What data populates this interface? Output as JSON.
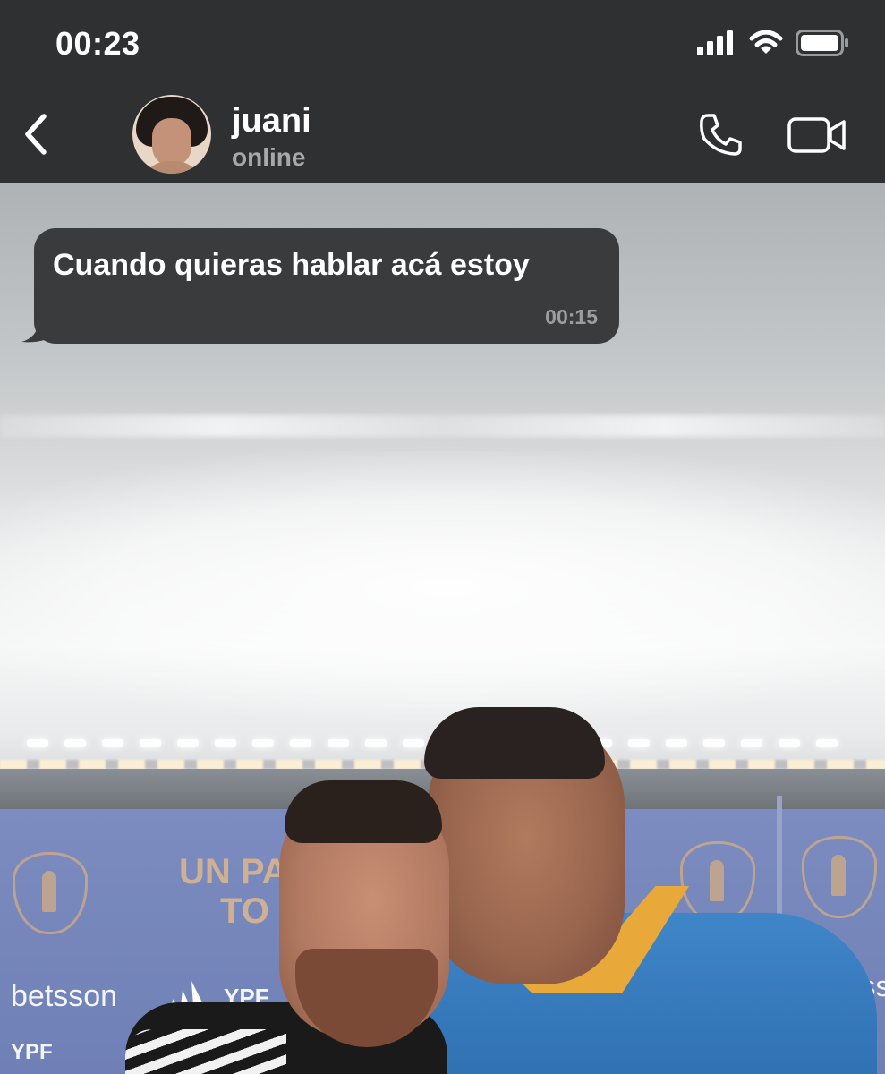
{
  "status_bar": {
    "time": "00:23",
    "icons": [
      "signal-icon",
      "wifi-icon",
      "battery-icon"
    ]
  },
  "header": {
    "back_icon": "chevron-left-icon",
    "contact_name": "juani",
    "contact_status": "online",
    "actions": [
      "phone-icon",
      "video-camera-icon"
    ]
  },
  "messages": [
    {
      "direction": "incoming",
      "text": "Cuando quieras hablar acá estoy",
      "time": "00:15"
    }
  ],
  "wallpaper": {
    "banner_text_line1": "UN PA",
    "banner_text_line2": "TO",
    "sponsors": [
      "betsson",
      "YPF",
      "YPF",
      "betss"
    ]
  },
  "colors": {
    "header_bg": "#2f3032",
    "bubble_bg": "#3a3b3d",
    "text_primary": "#ffffff",
    "text_secondary": "#a7a8ab"
  }
}
